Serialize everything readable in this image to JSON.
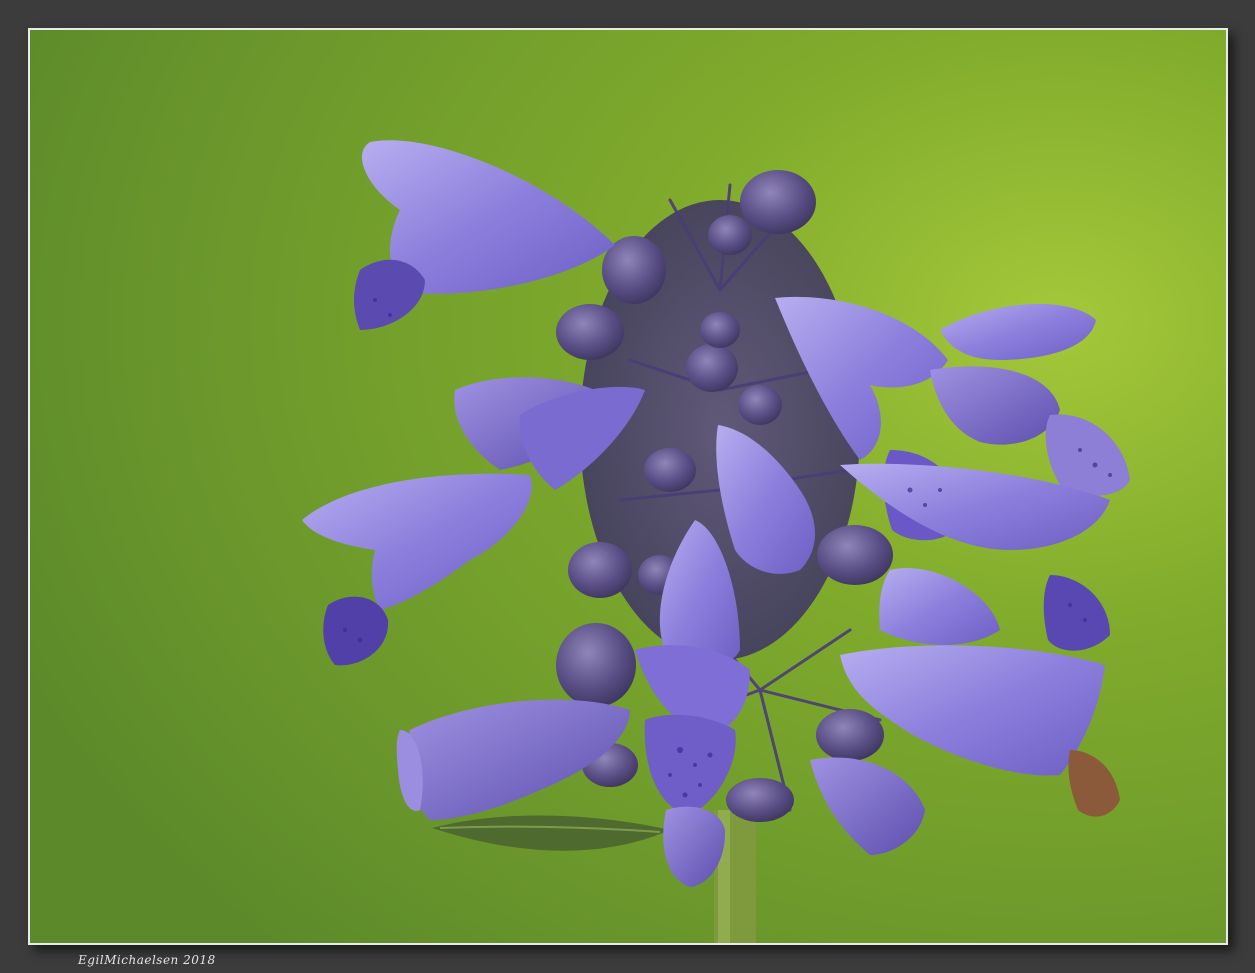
{
  "photo": {
    "subject": "purple-flower-spike",
    "background_color": "#6f9c2c",
    "petal_color": "#8a7ad8",
    "frame_color": "#e9ece6",
    "border_color": "#3b3c3b"
  },
  "watermark": {
    "signature": "EgilMichaelsen  2018"
  }
}
